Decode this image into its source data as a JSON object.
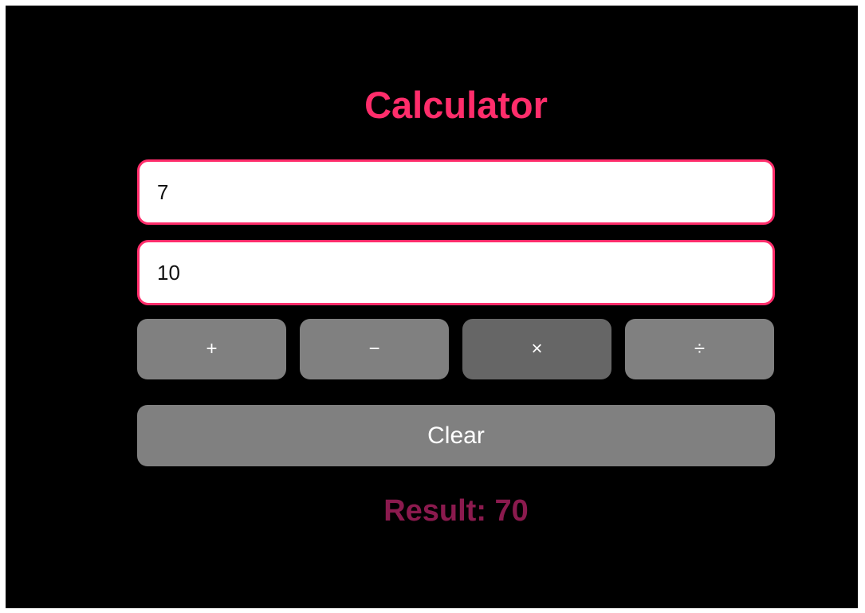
{
  "title": "Calculator",
  "inputs": {
    "first_value": "7",
    "second_value": "10"
  },
  "operations": [
    {
      "label": "+",
      "name": "add",
      "active": false
    },
    {
      "label": "−",
      "name": "subtract",
      "active": false
    },
    {
      "label": "×",
      "name": "multiply",
      "active": true
    },
    {
      "label": "÷",
      "name": "divide",
      "active": false
    }
  ],
  "clear_label": "Clear",
  "result_text": "Result: 70",
  "colors": {
    "accent": "#ff2d6b",
    "result": "#8b1a4e",
    "button": "#808080",
    "button_active": "#666666",
    "background": "#000000"
  }
}
